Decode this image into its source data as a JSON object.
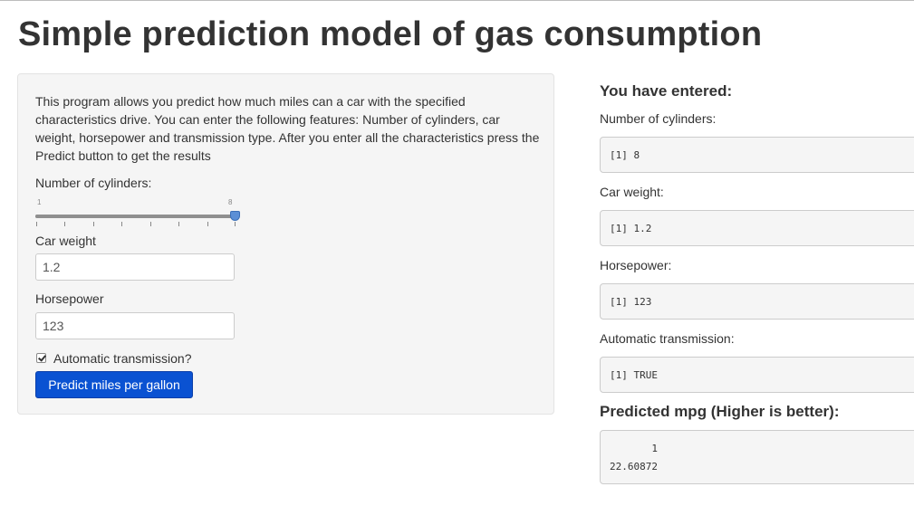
{
  "page": {
    "title": "Simple prediction model of gas consumption"
  },
  "sidebar": {
    "description": "This program allows you predict how much miles can a car with the specified characteristics drive. You can enter the following features: Number of cylinders, car weight, horsepower and transmission type. After you enter all the characteristics press the Predict button to get the results",
    "cylinders": {
      "label": "Number of cylinders:",
      "min_label": "1",
      "max_label": "8",
      "value": 8,
      "min": 1,
      "max": 8
    },
    "weight": {
      "label": "Car weight",
      "value": "1.2"
    },
    "horsepower": {
      "label": "Horsepower",
      "value": "123"
    },
    "transmission": {
      "label": "Automatic transmission?",
      "checked": true
    },
    "predict_button": "Predict miles per gallon"
  },
  "output": {
    "entered_heading": "You have entered:",
    "cylinders_label": "Number of cylinders:",
    "cylinders_value": "[1] 8",
    "weight_label": "Car weight:",
    "weight_value": "[1] 1.2",
    "horsepower_label": "Horsepower:",
    "horsepower_value": "[1] 123",
    "transmission_label": "Automatic transmission:",
    "transmission_value": "[1] TRUE",
    "predicted_heading": "Predicted mpg (Higher is better):",
    "predicted_value": "       1\n22.60872"
  },
  "colors": {
    "button": "#0a52d2",
    "panel": "#f5f5f5",
    "slider_handle": "#5b8fd6"
  }
}
